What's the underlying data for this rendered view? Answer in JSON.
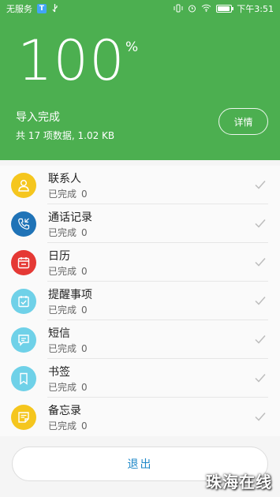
{
  "status_bar": {
    "carrier": "无服务",
    "time": "下午3:51",
    "battery_level": 0.9,
    "icons": [
      "t-badge-icon",
      "usb-icon",
      "vibrate-icon",
      "alarm-icon",
      "wifi-icon",
      "battery-icon"
    ]
  },
  "hero": {
    "percent": "100",
    "percent_sign": "%",
    "status": "导入完成",
    "summary": "共 17 项数据, 1.02 KB",
    "details_label": "详情",
    "background": "#4caf50"
  },
  "items": [
    {
      "title": "联系人",
      "state": "已完成",
      "count": "0",
      "icon": "contacts-icon",
      "color": "#f5c61e"
    },
    {
      "title": "通话记录",
      "state": "已完成",
      "count": "0",
      "icon": "phone-icon",
      "color": "#1f73b7"
    },
    {
      "title": "日历",
      "state": "已完成",
      "count": "0",
      "icon": "calendar-icon",
      "color": "#e53935"
    },
    {
      "title": "提醒事项",
      "state": "已完成",
      "count": "0",
      "icon": "reminder-icon",
      "color": "#6fd1e8"
    },
    {
      "title": "短信",
      "state": "已完成",
      "count": "0",
      "icon": "message-icon",
      "color": "#6fd1e8"
    },
    {
      "title": "书签",
      "state": "已完成",
      "count": "0",
      "icon": "bookmark-icon",
      "color": "#6fd1e8"
    },
    {
      "title": "备忘录",
      "state": "已完成",
      "count": "0",
      "icon": "memo-icon",
      "color": "#f5c61e"
    }
  ],
  "exit_label": "退出",
  "watermark": "珠海在线"
}
